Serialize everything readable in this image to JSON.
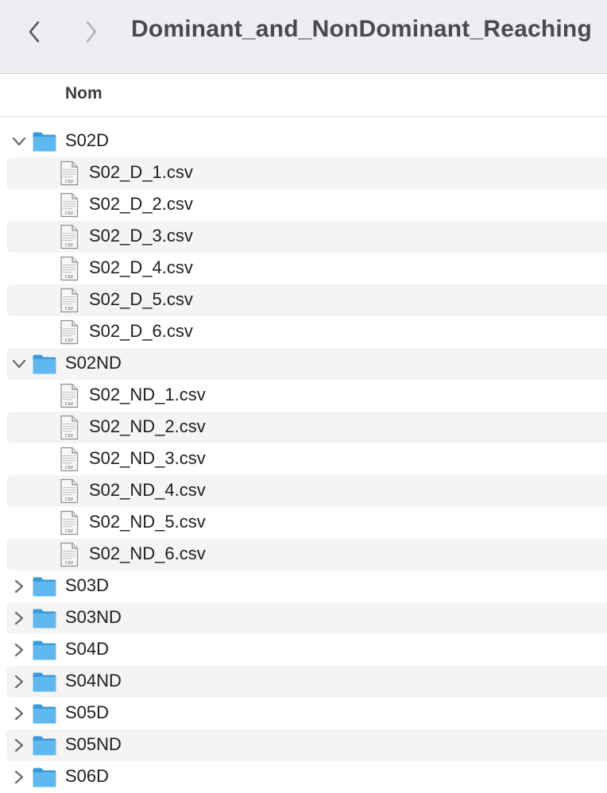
{
  "window": {
    "title": "Dominant_and_NonDominant_Reaching"
  },
  "toolbar": {
    "back_icon": "chevron-left-icon",
    "forward_icon": "chevron-right-icon"
  },
  "columns": {
    "name_label": "Nom"
  },
  "colors": {
    "toolbar_bg": "#efedf4",
    "folder_blue": "#5fb8ef",
    "alt_row": "#f4f4f5"
  },
  "rows": [
    {
      "type": "folder",
      "label": "S02D",
      "expanded": true
    },
    {
      "type": "file",
      "label": "S02_D_1.csv",
      "file_badge": "CSV"
    },
    {
      "type": "file",
      "label": "S02_D_2.csv",
      "file_badge": "CSV"
    },
    {
      "type": "file",
      "label": "S02_D_3.csv",
      "file_badge": "CSV"
    },
    {
      "type": "file",
      "label": "S02_D_4.csv",
      "file_badge": "CSV"
    },
    {
      "type": "file",
      "label": "S02_D_5.csv",
      "file_badge": "CSV"
    },
    {
      "type": "file",
      "label": "S02_D_6.csv",
      "file_badge": "CSV"
    },
    {
      "type": "folder",
      "label": "S02ND",
      "expanded": true
    },
    {
      "type": "file",
      "label": "S02_ND_1.csv",
      "file_badge": "CSV"
    },
    {
      "type": "file",
      "label": "S02_ND_2.csv",
      "file_badge": "CSV"
    },
    {
      "type": "file",
      "label": "S02_ND_3.csv",
      "file_badge": "CSV"
    },
    {
      "type": "file",
      "label": "S02_ND_4.csv",
      "file_badge": "CSV"
    },
    {
      "type": "file",
      "label": "S02_ND_5.csv",
      "file_badge": "CSV"
    },
    {
      "type": "file",
      "label": "S02_ND_6.csv",
      "file_badge": "CSV"
    },
    {
      "type": "folder",
      "label": "S03D",
      "expanded": false
    },
    {
      "type": "folder",
      "label": "S03ND",
      "expanded": false
    },
    {
      "type": "folder",
      "label": "S04D",
      "expanded": false
    },
    {
      "type": "folder",
      "label": "S04ND",
      "expanded": false
    },
    {
      "type": "folder",
      "label": "S05D",
      "expanded": false
    },
    {
      "type": "folder",
      "label": "S05ND",
      "expanded": false
    },
    {
      "type": "folder",
      "label": "S06D",
      "expanded": false
    }
  ]
}
